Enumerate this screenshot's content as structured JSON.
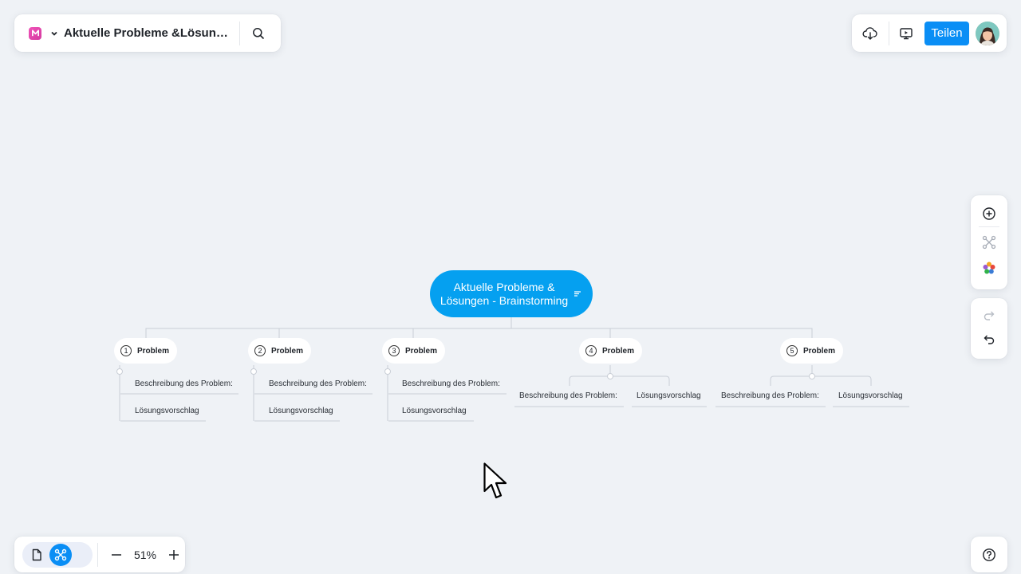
{
  "title_bar": {
    "doc_title": "Aktuelle Probleme &Lösunge..."
  },
  "top_right": {
    "share_label": "Teilen"
  },
  "zoom": {
    "level": "51%"
  },
  "mindmap": {
    "root": {
      "line1": "Aktuelle Probleme &",
      "line2": "Lösungen - Brainstorming"
    },
    "problems": [
      {
        "number": "1",
        "label": "Problem",
        "desc": "Beschreibung des Problem:",
        "solution": "Lösungsvorschlag"
      },
      {
        "number": "2",
        "label": "Problem",
        "desc": "Beschreibung des Problem:",
        "solution": "Lösungsvorschlag"
      },
      {
        "number": "3",
        "label": "Problem",
        "desc": "Beschreibung des Problem:",
        "solution": "Lösungsvorschlag"
      },
      {
        "number": "4",
        "label": "Problem",
        "desc": "Beschreibung des Problem:",
        "solution": "Lösungsvorschlag"
      },
      {
        "number": "5",
        "label": "Problem",
        "desc": "Beschreibung des Problem:",
        "solution": "Lösungsvorschlag"
      }
    ]
  },
  "colors": {
    "accent": "#0a8ef5",
    "root": "#05a0f0",
    "canvas": "#eff2f6",
    "connector": "#c9ced6"
  },
  "icons": [
    "mindmap-logo-icon",
    "chevron-down-icon",
    "search-icon",
    "cloud-download-icon",
    "present-icon",
    "add-topic-icon",
    "structure-icon",
    "theme-palette-icon",
    "redo-icon",
    "undo-icon",
    "outline-view-icon",
    "mindmap-view-icon",
    "zoom-out-icon",
    "zoom-in-icon",
    "help-icon",
    "cursor-icon"
  ]
}
